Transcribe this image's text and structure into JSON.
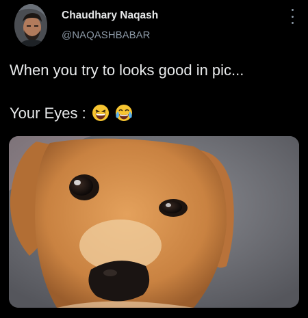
{
  "tweet": {
    "author_name": "Chaudhary Naqash",
    "author_handle": "@NAQASHBABAR",
    "line1": "When you try to looks good in pic...",
    "line2_prefix": "Your Eyes : ",
    "emojis": [
      "grinning-squinting-face-icon",
      "face-with-tears-of-joy-icon"
    ]
  },
  "colors": {
    "background": "#000000",
    "primary_text": "#e7e9ea",
    "secondary_text": "#8b98a5"
  }
}
